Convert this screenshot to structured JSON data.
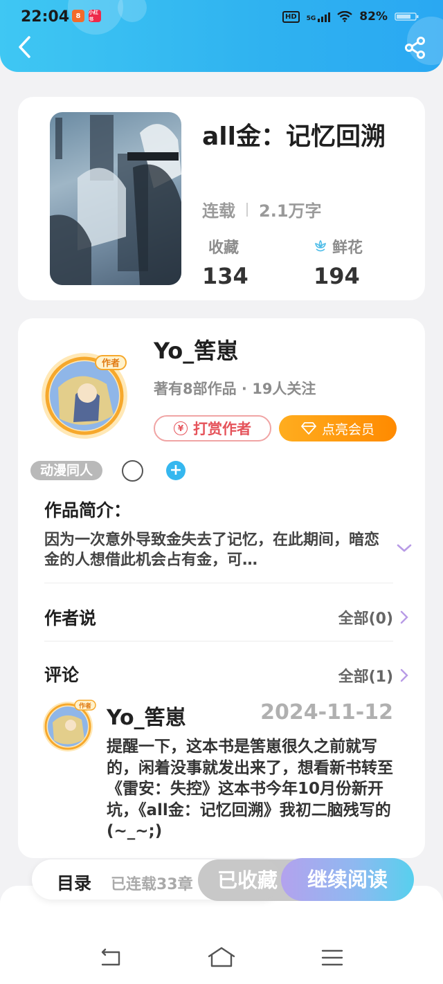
{
  "status_bar": {
    "time": "22:04",
    "app_icon_1_text": "8",
    "app_icon_2_text": "小红书",
    "hd": "HD",
    "network": "5G",
    "battery": "82%"
  },
  "header": {
    "back_icon": "chevron-left-icon",
    "share_icon": "share-icon"
  },
  "book": {
    "title": "all金：记忆回溯",
    "status": "连载",
    "word_count": "2.1万字",
    "favorites_label": "收藏",
    "favorites_value": "134",
    "flowers_label": "鲜花",
    "flowers_value": "194"
  },
  "author": {
    "name": "Yo_筈崽",
    "avatar_badge": "作者",
    "stats": "著有8部作品 · 19人关注",
    "tip_button": "打赏作者",
    "tip_symbol": "¥",
    "vip_button": "点亮会员"
  },
  "tags": {
    "genre": "动漫同人",
    "add_symbol": "+"
  },
  "synopsis": {
    "heading": "作品简介：",
    "text": "因为一次意外导致金失去了记忆，在此期间，暗恋金的人想借此机会占有金，可…"
  },
  "author_says": {
    "heading": "作者说",
    "all_link": "全部(0)"
  },
  "comments": {
    "heading": "评论",
    "all_link": "全部(1)",
    "items": [
      {
        "user": "Yo_筈崽",
        "badge": "作者",
        "date": "2024-11-12",
        "text": "提醒一下，这本书是筈崽很久之前就写的，闲着没事就发出来了，想看新书转至《雷安：失控》这本书今年10月份新开坑，《all金：记忆回溯》我初二脑残写的(~_~;)"
      }
    ]
  },
  "bottom_bar": {
    "toc_label": "目录",
    "toc_status": "已连载33章",
    "favorited_button": "已收藏",
    "continue_button": "继续阅读"
  },
  "nav_bar": {
    "back": "nav-back-icon",
    "home": "nav-home-icon",
    "menu": "nav-menu-icon"
  },
  "colors": {
    "header_blue": "#2fb2f0",
    "tip_red": "#e5535a",
    "vip_orange": "#ff8a00",
    "tag_add_blue": "#35b7ef",
    "chevron_purple": "#b89be6"
  }
}
